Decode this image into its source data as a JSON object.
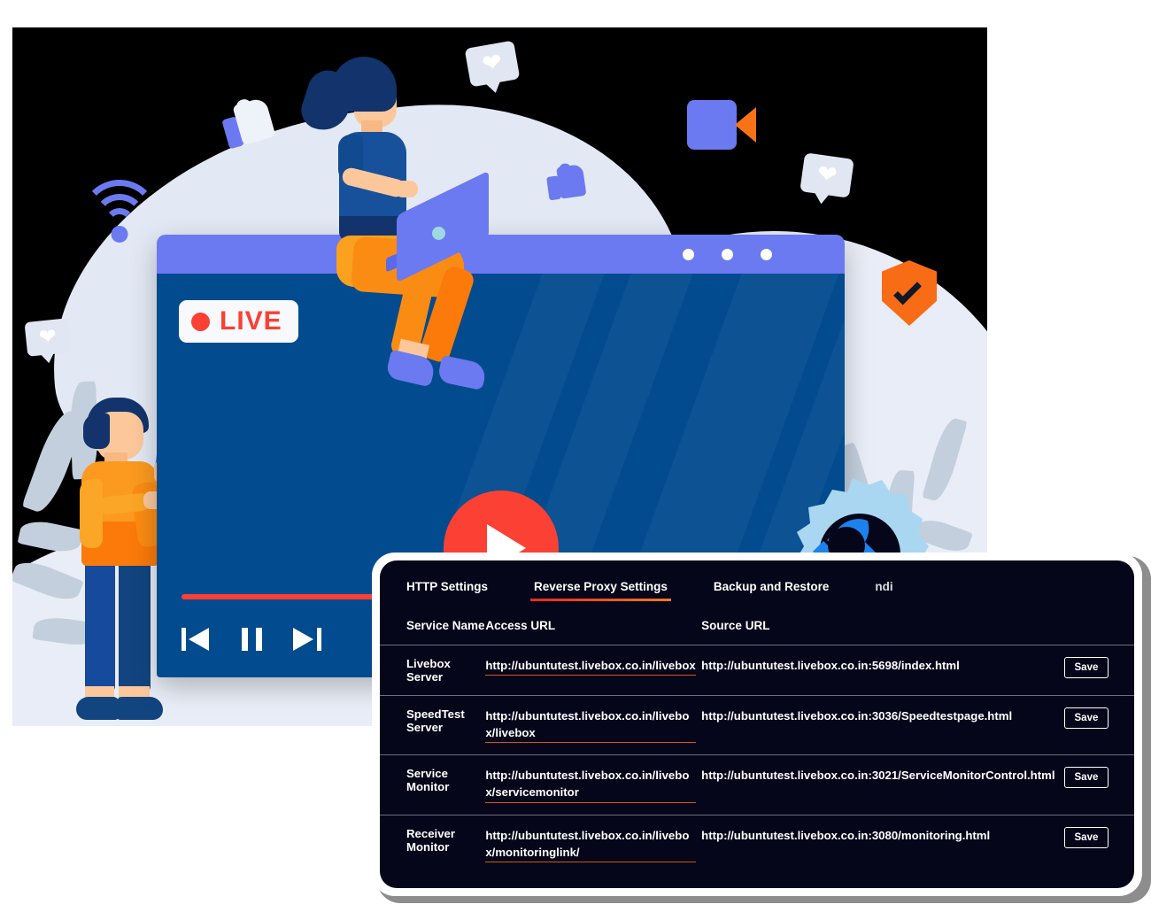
{
  "illustration": {
    "live_badge": {
      "label": "LIVE",
      "dot": "red-dot-icon",
      "text_color": "#fb4034"
    },
    "browser_window": {
      "dots": [
        "window-dot-1",
        "window-dot-2",
        "window-dot-3"
      ],
      "bar_color": "#6b7af0",
      "body_color": "#034b8f"
    },
    "player_controls": {
      "previous": "previous-track-icon",
      "pause": "pause-icon",
      "next": "next-track-icon",
      "play": "play-icon",
      "progress_color": "#fb4034"
    },
    "floating_icons": [
      "thumbs-up-icon",
      "thumbs-up-icon",
      "heart-bubble-icon",
      "heart-bubble-icon",
      "heart-bubble-icon",
      "video-camera-icon",
      "shield-check-icon",
      "wifi-icon",
      "gear-wrench-icon"
    ],
    "characters": [
      "woman-with-laptop",
      "man-with-phone"
    ]
  },
  "panel": {
    "tabs": [
      {
        "label": "HTTP Settings",
        "active": false
      },
      {
        "label": "Reverse Proxy Settings",
        "active": true
      },
      {
        "label": "Backup and Restore",
        "active": false
      },
      {
        "label": "ndi",
        "active": false
      }
    ],
    "table": {
      "headers": [
        "Service Name",
        "Access URL",
        "Source URL",
        ""
      ],
      "rows": [
        {
          "service": "Livebox Server",
          "access_url": "http://ubuntutest.livebox.co.in/livebox",
          "source_url": "http://ubuntutest.livebox.co.in:5698/index.html",
          "save_label": "Save"
        },
        {
          "service": "SpeedTest Server",
          "access_url": "http://ubuntutest.livebox.co.in/livebox/livebox",
          "source_url": "http://ubuntutest.livebox.co.in:3036/Speedtestpage.html",
          "save_label": "Save"
        },
        {
          "service": "Service Monitor",
          "access_url": "http://ubuntutest.livebox.co.in/livebox/servicemonitor",
          "source_url": "http://ubuntutest.livebox.co.in:3021/ServiceMonitorControl.html",
          "save_label": "Save"
        },
        {
          "service": "Receiver Monitor",
          "access_url": "http://ubuntutest.livebox.co.in/livebox/monitoringlink/",
          "source_url": "http://ubuntutest.livebox.co.in:3080/monitoring.html",
          "save_label": "Save"
        }
      ]
    },
    "colors": {
      "panel_bg": "#06061a",
      "accent_underline": "#d4550e",
      "tab_active_underline": "#e8291c",
      "border": "#6e6e80"
    }
  }
}
